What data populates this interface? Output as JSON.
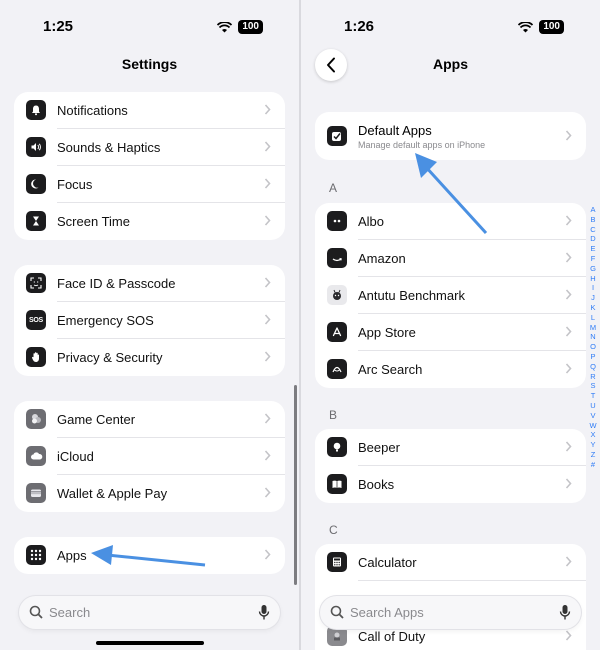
{
  "left": {
    "status": {
      "time": "1:25",
      "battery": "100"
    },
    "title": "Settings",
    "groups": [
      [
        {
          "label": "Notifications",
          "icon": "bell-icon",
          "color": "#1c1c1e"
        },
        {
          "label": "Sounds & Haptics",
          "icon": "speaker-icon",
          "color": "#1c1c1e"
        },
        {
          "label": "Focus",
          "icon": "moon-icon",
          "color": "#1c1c1e"
        },
        {
          "label": "Screen Time",
          "icon": "hourglass-icon",
          "color": "#1c1c1e"
        }
      ],
      [
        {
          "label": "Face ID & Passcode",
          "icon": "faceid-icon",
          "color": "#1c1c1e"
        },
        {
          "label": "Emergency SOS",
          "icon": "sos-icon",
          "color": "#1c1c1e"
        },
        {
          "label": "Privacy & Security",
          "icon": "hand-icon",
          "color": "#1c1c1e"
        }
      ],
      [
        {
          "label": "Game Center",
          "icon": "game-center-icon",
          "color": "#6d6d72"
        },
        {
          "label": "iCloud",
          "icon": "cloud-icon",
          "color": "#6d6d72"
        },
        {
          "label": "Wallet & Apple Pay",
          "icon": "wallet-icon",
          "color": "#6d6d72"
        }
      ],
      [
        {
          "label": "Apps",
          "icon": "apps-grid-icon",
          "color": "#1c1c1e"
        }
      ]
    ],
    "search_placeholder": "Search"
  },
  "right": {
    "status": {
      "time": "1:26",
      "battery": "100"
    },
    "title": "Apps",
    "default_apps": {
      "label": "Default Apps",
      "subtitle": "Manage default apps on iPhone"
    },
    "sections": [
      {
        "letter": "A",
        "items": [
          {
            "label": "Albo",
            "icon": "albo-icon"
          },
          {
            "label": "Amazon",
            "icon": "amazon-icon"
          },
          {
            "label": "Antutu Benchmark",
            "icon": "antutu-icon"
          },
          {
            "label": "App Store",
            "icon": "app-store-icon"
          },
          {
            "label": "Arc Search",
            "icon": "arc-search-icon"
          }
        ]
      },
      {
        "letter": "B",
        "items": [
          {
            "label": "Beeper",
            "icon": "beeper-icon"
          },
          {
            "label": "Books",
            "icon": "books-icon"
          }
        ]
      },
      {
        "letter": "C",
        "items": [
          {
            "label": "Calculator",
            "icon": "calculator-icon"
          },
          {
            "label": "Call of Duty",
            "icon": "call-of-duty-icon"
          }
        ]
      }
    ],
    "index_letters": [
      "A",
      "B",
      "C",
      "D",
      "E",
      "F",
      "G",
      "H",
      "I",
      "J",
      "K",
      "L",
      "M",
      "N",
      "O",
      "P",
      "Q",
      "R",
      "S",
      "T",
      "U",
      "V",
      "W",
      "X",
      "Y",
      "Z",
      "#"
    ],
    "search_placeholder": "Search Apps"
  },
  "colors": {
    "accent": "#2f7cf6",
    "arrow": "#4a90e2"
  }
}
